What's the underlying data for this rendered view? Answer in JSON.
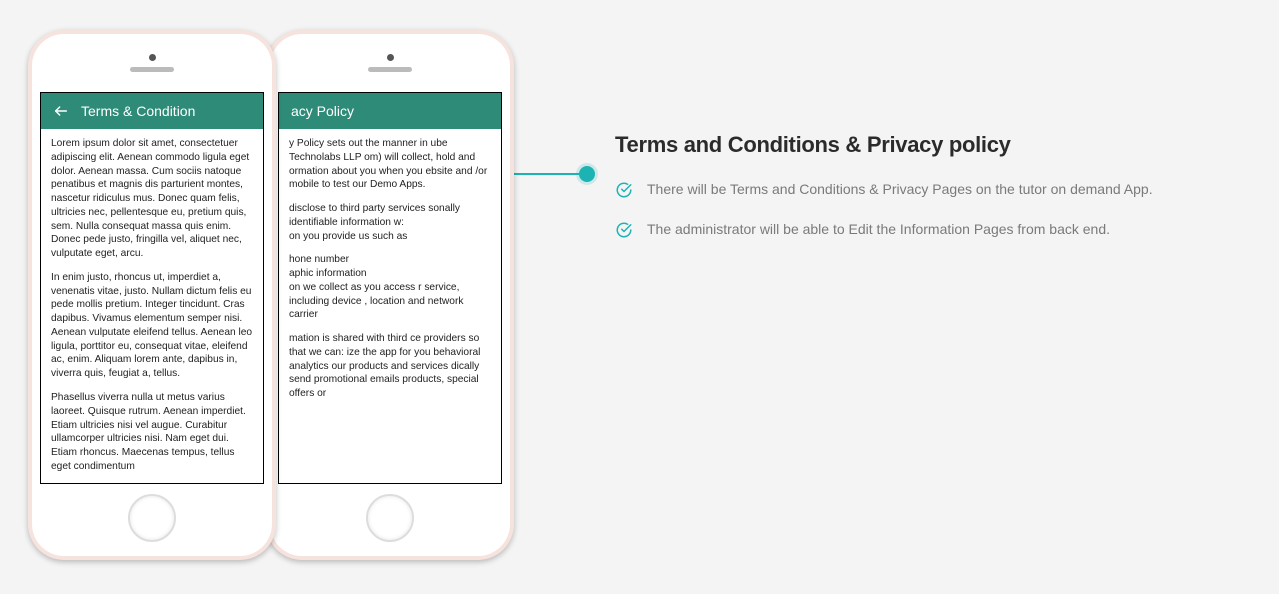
{
  "content": {
    "heading": "Terms and Conditions & Privacy policy",
    "features": [
      "There will be Terms and Conditions & Privacy Pages on the tutor on demand App.",
      "The administrator will be able to Edit the Information Pages from back end."
    ]
  },
  "phone1": {
    "header_title": "Terms & Condition",
    "para1": "Lorem ipsum dolor sit amet, consectetuer adipiscing elit. Aenean commodo ligula eget dolor. Aenean massa. Cum sociis natoque penatibus et magnis dis parturient montes, nascetur ridiculus mus. Donec quam felis, ultricies nec, pellentesque eu, pretium quis, sem. Nulla consequat massa quis enim. Donec pede justo, fringilla vel, aliquet nec, vulputate eget, arcu.",
    "para2": "In enim justo, rhoncus ut, imperdiet a, venenatis vitae, justo. Nullam dictum felis eu pede mollis pretium. Integer tincidunt. Cras dapibus. Vivamus elementum semper nisi. Aenean vulputate eleifend tellus. Aenean leo ligula, porttitor eu, consequat vitae, eleifend ac, enim. Aliquam lorem ante, dapibus in, viverra quis, feugiat a, tellus.",
    "para3": "Phasellus viverra nulla ut metus varius laoreet. Quisque rutrum. Aenean imperdiet. Etiam ultricies nisi vel augue. Curabitur ullamcorper ultricies nisi. Nam eget dui. Etiam rhoncus. Maecenas tempus, tellus eget condimentum"
  },
  "phone2": {
    "header_title": "acy Policy",
    "para1": "y Policy sets out the manner in ube Technolabs LLP om) will collect, hold and ormation about you when you ebsite and /or mobile to test our Demo Apps.",
    "para2": "disclose to third party services sonally identifiable information w:\non you provide us such as",
    "para3": "hone number\naphic information\non we collect as you access r service, including device , location and network carrier",
    "para4": "mation is shared with third ce providers so that we can: ize the app for you behavioral analytics our products and services dically send promotional emails products, special offers or"
  }
}
